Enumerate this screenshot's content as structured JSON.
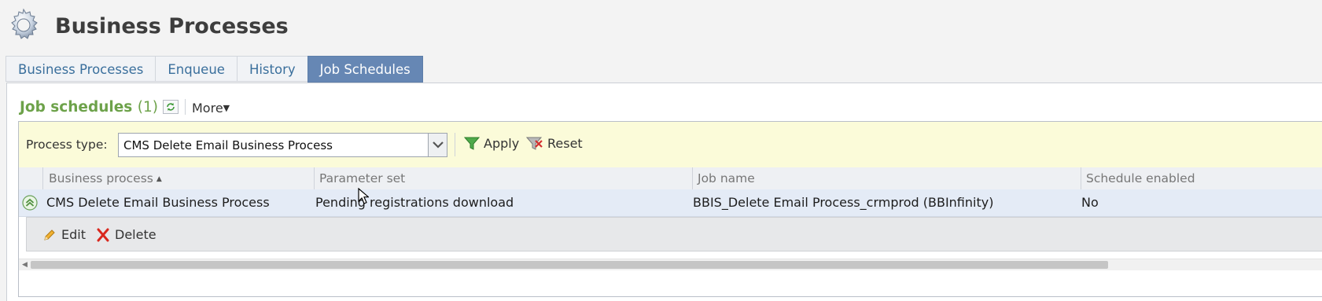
{
  "header": {
    "title": "Business Processes",
    "icon": "gear-icon"
  },
  "tabs": [
    {
      "label": "Business Processes",
      "active": false
    },
    {
      "label": "Enqueue",
      "active": false
    },
    {
      "label": "History",
      "active": false
    },
    {
      "label": "Job Schedules",
      "active": true
    }
  ],
  "section": {
    "title": "Job schedules",
    "count": "(1)",
    "more_label": "More"
  },
  "filter": {
    "label": "Process type:",
    "value": "CMS Delete Email Business Process",
    "apply_label": "Apply",
    "reset_label": "Reset"
  },
  "grid": {
    "columns": [
      "Business process",
      "Parameter set",
      "Job name",
      "Schedule enabled"
    ],
    "sort_column": "Business process",
    "sort_direction": "ascending",
    "rows": [
      {
        "business_process": "CMS Delete Email Business Process",
        "parameter_set": "Pending registrations download",
        "job_name": "BBIS_Delete Email Process_crmprod (BBInfinity)",
        "schedule_enabled": "No"
      }
    ],
    "row_actions": {
      "edit_label": "Edit",
      "delete_label": "Delete"
    }
  },
  "colors": {
    "active_tab": "#6687b4",
    "tab_text": "#3a6f9c",
    "section_title": "#6da24a",
    "filter_bar": "#fbfbd9",
    "selected_row": "#e4ebf6"
  }
}
